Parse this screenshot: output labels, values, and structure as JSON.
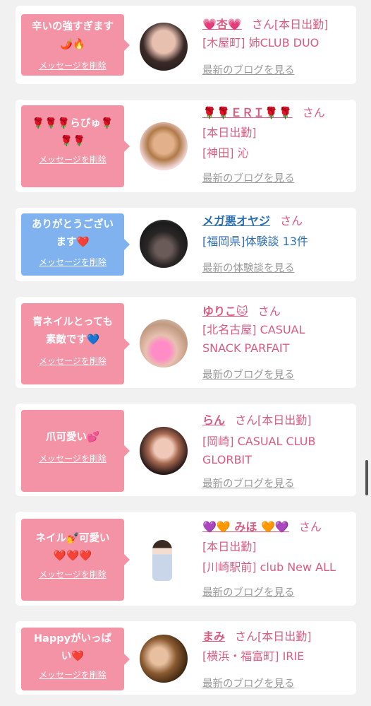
{
  "entries": [
    {
      "message": "辛いの強すぎます\n🌶️🔥",
      "delete_label": "メッセージを削除",
      "name": "💗杏💗",
      "honorific": "さん[本日出勤]",
      "details": "[木屋町] 姉CLUB DUO",
      "link": "最新のブログを見る",
      "bubble_color": "#f493a6"
    },
    {
      "message": "🌹🌹🌹らぴゅ🌹\n🌹🌹",
      "delete_label": "メッセージを削除",
      "name": "🌹🌹ＥＲＩ🌹🌹",
      "honorific": "さん",
      "details": "[本日出勤]\n[神田] 沁",
      "link": "最新のブログを見る",
      "bubble_color": "#f493a6"
    },
    {
      "message": "ありがとうござい\nます❤️",
      "delete_label": "メッセージを削除",
      "name": "メガ悪オヤジ",
      "honorific": "さん",
      "details": "[福岡県]体験談 13件",
      "link": "最新の体験談を見る",
      "bubble_color": "#7fb2ee"
    },
    {
      "message": "青ネイルとっても\n素敵です💙",
      "delete_label": "メッセージを削除",
      "name": "ゆりこ🐱",
      "honorific": "さん",
      "details": "[北名古屋] CASUAL\nSNACK PARFAIT",
      "link": "最新のブログを見る",
      "bubble_color": "#f493a6"
    },
    {
      "message": "爪可愛い💕",
      "delete_label": "メッセージを削除",
      "name": "らん",
      "honorific": "さん[本日出勤]",
      "details": "[岡崎] CASUAL CLUB\nGLORBIT",
      "link": "最新のブログを見る",
      "bubble_color": "#f493a6"
    },
    {
      "message": "ネイル💅可愛い\n❤️❤️❤️",
      "delete_label": "メッセージを削除",
      "name": "💜🧡 みほ 🧡💜",
      "honorific": "さん",
      "details": "[本日出勤]\n[川崎駅前] club New ALL",
      "link": "最新のブログを見る",
      "bubble_color": "#f493a6"
    },
    {
      "message": "Happyがいっぱ\nい❤️",
      "delete_label": "メッセージを削除",
      "name": "まみ",
      "honorific": "さん[本日出勤]",
      "details": "[横浜・福富町] IRIE",
      "link": "最新のブログを見る",
      "bubble_color": "#f493a6"
    }
  ]
}
